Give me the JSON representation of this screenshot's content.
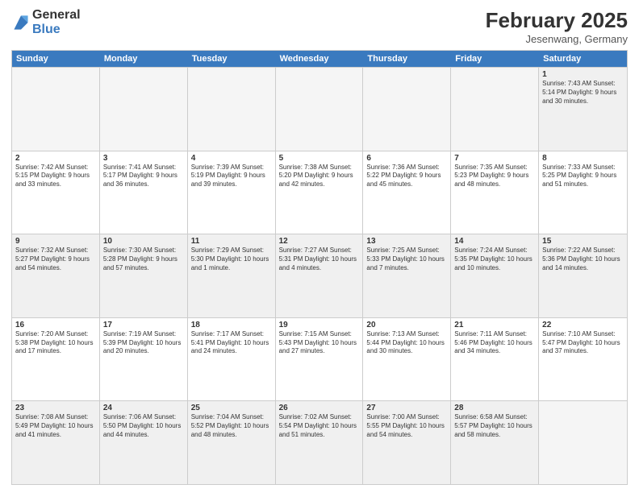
{
  "logo": {
    "general": "General",
    "blue": "Blue"
  },
  "header": {
    "month_year": "February 2025",
    "location": "Jesenwang, Germany"
  },
  "days_of_week": [
    "Sunday",
    "Monday",
    "Tuesday",
    "Wednesday",
    "Thursday",
    "Friday",
    "Saturday"
  ],
  "weeks": [
    [
      {
        "day": "",
        "info": "",
        "empty": true
      },
      {
        "day": "",
        "info": "",
        "empty": true
      },
      {
        "day": "",
        "info": "",
        "empty": true
      },
      {
        "day": "",
        "info": "",
        "empty": true
      },
      {
        "day": "",
        "info": "",
        "empty": true
      },
      {
        "day": "",
        "info": "",
        "empty": true
      },
      {
        "day": "1",
        "info": "Sunrise: 7:43 AM\nSunset: 5:14 PM\nDaylight: 9 hours and 30 minutes.",
        "empty": false
      }
    ],
    [
      {
        "day": "2",
        "info": "Sunrise: 7:42 AM\nSunset: 5:15 PM\nDaylight: 9 hours and 33 minutes.",
        "empty": false
      },
      {
        "day": "3",
        "info": "Sunrise: 7:41 AM\nSunset: 5:17 PM\nDaylight: 9 hours and 36 minutes.",
        "empty": false
      },
      {
        "day": "4",
        "info": "Sunrise: 7:39 AM\nSunset: 5:19 PM\nDaylight: 9 hours and 39 minutes.",
        "empty": false
      },
      {
        "day": "5",
        "info": "Sunrise: 7:38 AM\nSunset: 5:20 PM\nDaylight: 9 hours and 42 minutes.",
        "empty": false
      },
      {
        "day": "6",
        "info": "Sunrise: 7:36 AM\nSunset: 5:22 PM\nDaylight: 9 hours and 45 minutes.",
        "empty": false
      },
      {
        "day": "7",
        "info": "Sunrise: 7:35 AM\nSunset: 5:23 PM\nDaylight: 9 hours and 48 minutes.",
        "empty": false
      },
      {
        "day": "8",
        "info": "Sunrise: 7:33 AM\nSunset: 5:25 PM\nDaylight: 9 hours and 51 minutes.",
        "empty": false
      }
    ],
    [
      {
        "day": "9",
        "info": "Sunrise: 7:32 AM\nSunset: 5:27 PM\nDaylight: 9 hours and 54 minutes.",
        "empty": false
      },
      {
        "day": "10",
        "info": "Sunrise: 7:30 AM\nSunset: 5:28 PM\nDaylight: 9 hours and 57 minutes.",
        "empty": false
      },
      {
        "day": "11",
        "info": "Sunrise: 7:29 AM\nSunset: 5:30 PM\nDaylight: 10 hours and 1 minute.",
        "empty": false
      },
      {
        "day": "12",
        "info": "Sunrise: 7:27 AM\nSunset: 5:31 PM\nDaylight: 10 hours and 4 minutes.",
        "empty": false
      },
      {
        "day": "13",
        "info": "Sunrise: 7:25 AM\nSunset: 5:33 PM\nDaylight: 10 hours and 7 minutes.",
        "empty": false
      },
      {
        "day": "14",
        "info": "Sunrise: 7:24 AM\nSunset: 5:35 PM\nDaylight: 10 hours and 10 minutes.",
        "empty": false
      },
      {
        "day": "15",
        "info": "Sunrise: 7:22 AM\nSunset: 5:36 PM\nDaylight: 10 hours and 14 minutes.",
        "empty": false
      }
    ],
    [
      {
        "day": "16",
        "info": "Sunrise: 7:20 AM\nSunset: 5:38 PM\nDaylight: 10 hours and 17 minutes.",
        "empty": false
      },
      {
        "day": "17",
        "info": "Sunrise: 7:19 AM\nSunset: 5:39 PM\nDaylight: 10 hours and 20 minutes.",
        "empty": false
      },
      {
        "day": "18",
        "info": "Sunrise: 7:17 AM\nSunset: 5:41 PM\nDaylight: 10 hours and 24 minutes.",
        "empty": false
      },
      {
        "day": "19",
        "info": "Sunrise: 7:15 AM\nSunset: 5:43 PM\nDaylight: 10 hours and 27 minutes.",
        "empty": false
      },
      {
        "day": "20",
        "info": "Sunrise: 7:13 AM\nSunset: 5:44 PM\nDaylight: 10 hours and 30 minutes.",
        "empty": false
      },
      {
        "day": "21",
        "info": "Sunrise: 7:11 AM\nSunset: 5:46 PM\nDaylight: 10 hours and 34 minutes.",
        "empty": false
      },
      {
        "day": "22",
        "info": "Sunrise: 7:10 AM\nSunset: 5:47 PM\nDaylight: 10 hours and 37 minutes.",
        "empty": false
      }
    ],
    [
      {
        "day": "23",
        "info": "Sunrise: 7:08 AM\nSunset: 5:49 PM\nDaylight: 10 hours and 41 minutes.",
        "empty": false
      },
      {
        "day": "24",
        "info": "Sunrise: 7:06 AM\nSunset: 5:50 PM\nDaylight: 10 hours and 44 minutes.",
        "empty": false
      },
      {
        "day": "25",
        "info": "Sunrise: 7:04 AM\nSunset: 5:52 PM\nDaylight: 10 hours and 48 minutes.",
        "empty": false
      },
      {
        "day": "26",
        "info": "Sunrise: 7:02 AM\nSunset: 5:54 PM\nDaylight: 10 hours and 51 minutes.",
        "empty": false
      },
      {
        "day": "27",
        "info": "Sunrise: 7:00 AM\nSunset: 5:55 PM\nDaylight: 10 hours and 54 minutes.",
        "empty": false
      },
      {
        "day": "28",
        "info": "Sunrise: 6:58 AM\nSunset: 5:57 PM\nDaylight: 10 hours and 58 minutes.",
        "empty": false
      },
      {
        "day": "",
        "info": "",
        "empty": true
      }
    ]
  ]
}
